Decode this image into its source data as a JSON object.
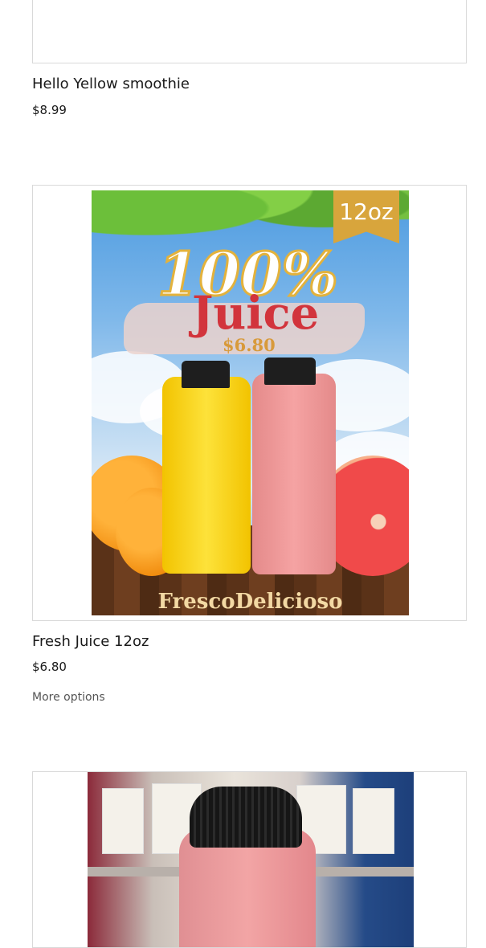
{
  "products": [
    {
      "name": "Hello Yellow smoothie",
      "price": "$8.99"
    },
    {
      "name": "Fresh Juice 12oz",
      "price": "$6.80",
      "more_options": "More options",
      "poster": {
        "size_badge": "12oz",
        "headline_percent": "100%",
        "headline_word": "Juice",
        "price_text": "$6.80",
        "brand": "FrescoDelicioso"
      }
    },
    {
      "name": "",
      "price": ""
    }
  ],
  "colors": {
    "border": "#d9d9d9",
    "text": "#1a1a1a",
    "muted": "#555555",
    "poster_red": "#d2343c",
    "poster_gold": "#d8a53c"
  }
}
